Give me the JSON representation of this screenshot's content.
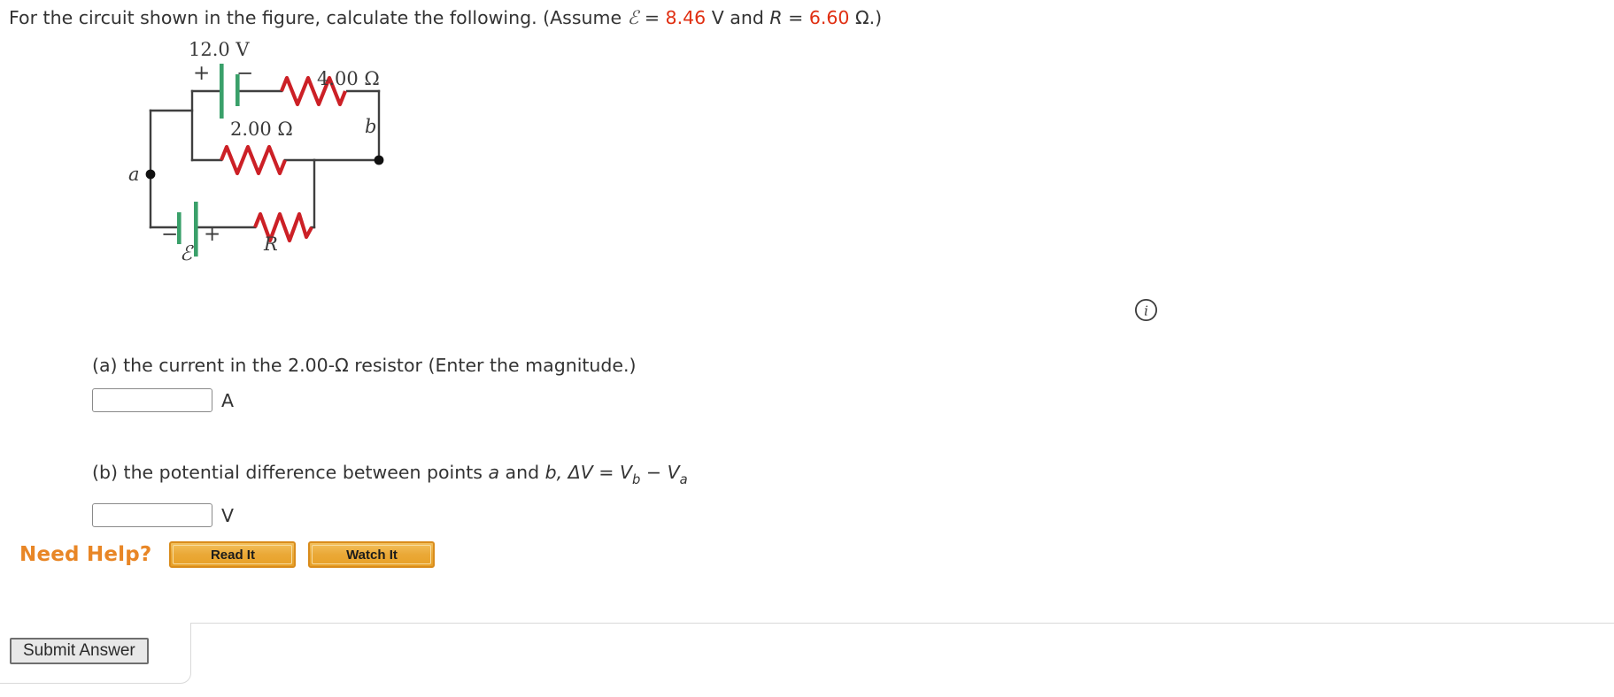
{
  "prompt": {
    "text_before_eps": "For the circuit shown in the figure, calculate the following. (Assume ",
    "eps_symbol": "ℰ",
    "eq1": " = ",
    "emf_value": "8.46",
    "emf_unit": " V and ",
    "r_symbol": "R",
    "eq2": " = ",
    "r_value": "6.60",
    "r_unit": " Ω.)",
    "accent_value_color": "#e02f12"
  },
  "figure": {
    "name": "circuit-diagram",
    "labels": {
      "top_battery_voltage": "12.0 V",
      "top_battery_plus": "+",
      "top_battery_minus": "−",
      "resistor_4ohm": "4.00 Ω",
      "resistor_2ohm": "2.00 Ω",
      "node_b": "b",
      "node_a": "a",
      "bottom_battery_minus": "−",
      "bottom_battery_plus": "+",
      "bottom_battery_emf": "ℰ",
      "resistor_R": "R"
    },
    "colors": {
      "wire": "#3f3f3f",
      "resistor": "#cc2026",
      "battery_plate": "#3aa06a",
      "node_dot": "#111111"
    }
  },
  "info_icon": {
    "name": "info-icon",
    "glyph": "i"
  },
  "questions": [
    {
      "id": "a",
      "label": "(a) the current in the 2.00-Ω resistor (Enter the magnitude.)",
      "input_value": "",
      "input_placeholder": "",
      "unit": "A"
    },
    {
      "id": "b",
      "label_part1": "(b) the potential difference between points ",
      "label_a": "a",
      "label_and": " and ",
      "label_b": "b",
      "label_part2": ", ΔV = V",
      "sub_b": "b",
      "label_minus": " − V",
      "sub_a": "a",
      "input_value": "",
      "input_placeholder": "",
      "unit": "V"
    }
  ],
  "need_help": {
    "label": "Need Help?",
    "label_color": "#e88626",
    "buttons": [
      {
        "name": "read-it-button",
        "label": "Read It"
      },
      {
        "name": "watch-it-button",
        "label": "Watch It"
      }
    ]
  },
  "submit": {
    "label": "Submit Answer"
  }
}
